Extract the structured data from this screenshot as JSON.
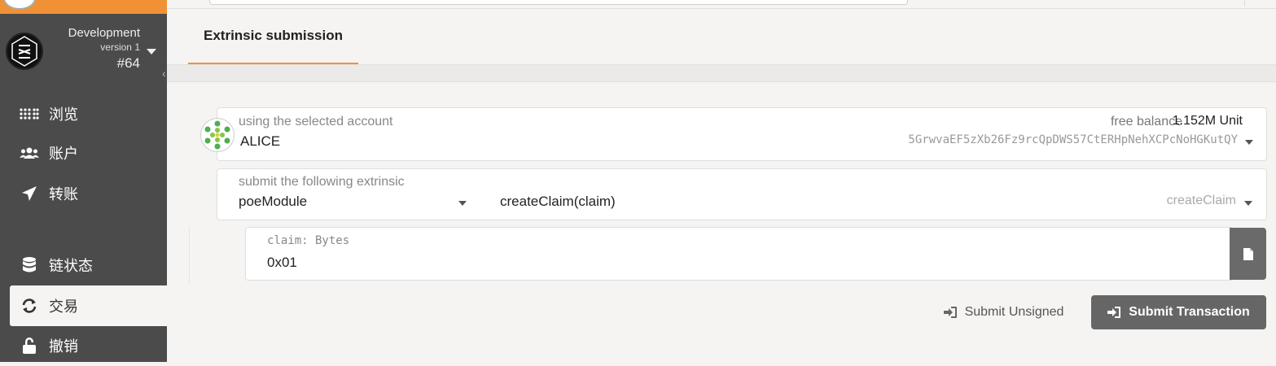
{
  "sidebar": {
    "chain": {
      "name": "Development",
      "version": "version 1",
      "block": "#64"
    },
    "items": [
      {
        "label": "浏览",
        "icon": "grid-icon"
      },
      {
        "label": "账户",
        "icon": "users-icon"
      },
      {
        "label": "转账",
        "icon": "send-icon"
      },
      {
        "label": "链状态",
        "icon": "database-icon"
      },
      {
        "label": "交易",
        "icon": "sync-icon",
        "active": true
      },
      {
        "label": "撤销",
        "icon": "unlock-icon"
      }
    ]
  },
  "tabs": [
    {
      "label": "Extrinsic submission",
      "active": true
    }
  ],
  "account": {
    "label": "using the selected account",
    "name": "ALICE",
    "balance_label": "free balance",
    "balance_value": "1.152M Unit",
    "address": "5GrwvaEF5zXb26Fz9rcQpDWS57CtERHpNehXCPcNoHGKutQY"
  },
  "extrinsic": {
    "label": "submit the following extrinsic",
    "module": "poeModule",
    "method_signature": "createClaim(claim)",
    "method": "createClaim"
  },
  "param": {
    "label": "claim: Bytes",
    "value": "0x01"
  },
  "actions": {
    "unsigned": "Submit Unsigned",
    "submit": "Submit Transaction"
  },
  "colors": {
    "accent": "#f19135",
    "sidebar": "#4b4b4b",
    "button": "#666666"
  }
}
